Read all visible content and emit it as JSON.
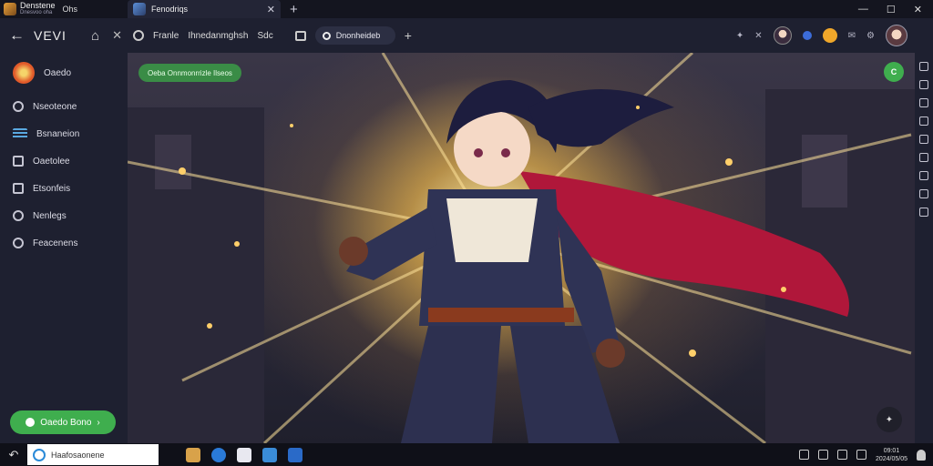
{
  "app": {
    "name": "Denstene",
    "subtitle": "Dnesvoo oha",
    "secondary": "Ohs"
  },
  "tab": {
    "title": "Fenodriqs"
  },
  "toolbar": {
    "view_label": "VEVI",
    "nav_text": "Franle",
    "nav_text2": "Ihnedanmghsh",
    "nav_text3": "Sdc",
    "search_value": "Dnonheideb"
  },
  "sidebar": {
    "items": [
      {
        "label": "Oaedo",
        "icon": "app-logo-icon"
      },
      {
        "label": "Nseoteone",
        "icon": "triangle-icon"
      },
      {
        "label": "Bsnaneion",
        "icon": "list-icon"
      },
      {
        "label": "Oaetolee",
        "icon": "monitor-icon"
      },
      {
        "label": "Etsonfeis",
        "icon": "window-icon"
      },
      {
        "label": "Nenlegs",
        "icon": "gear-icon"
      },
      {
        "label": "Feacenens",
        "icon": "user-icon"
      }
    ],
    "cta_label": "Oaedo Bono"
  },
  "main": {
    "badge": "Oeba Onnmonrrizle Ilseos",
    "fab_label": "C"
  },
  "taskbar": {
    "search_value": "Haafosaonene",
    "clock_time": "09:01",
    "clock_date": "2024/05/05"
  },
  "colors": {
    "accent": "#3fae4e",
    "bg": "#1e2030",
    "glow": "#ffd86a"
  }
}
